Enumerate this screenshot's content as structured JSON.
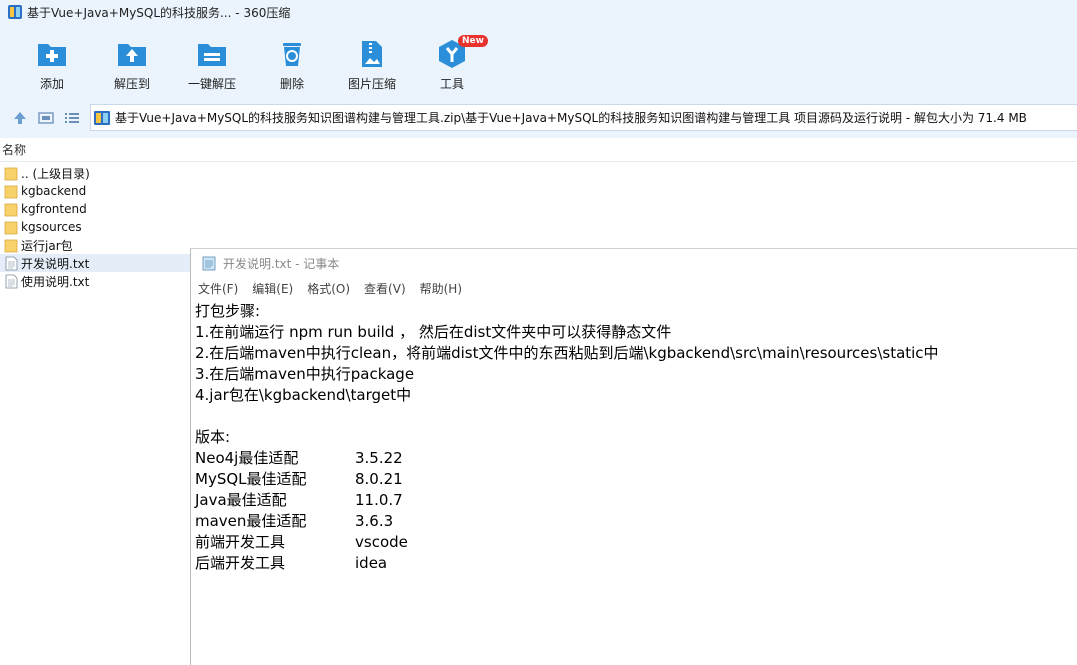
{
  "window": {
    "title": "基于Vue+Java+MySQL的科技服务... - 360压缩"
  },
  "toolbar": {
    "buttons": [
      {
        "label": "添加",
        "icon": "add-icon"
      },
      {
        "label": "解压到",
        "icon": "extract-to-icon"
      },
      {
        "label": "一键解压",
        "icon": "one-click-extract-icon"
      },
      {
        "label": "删除",
        "icon": "delete-icon"
      },
      {
        "label": "图片压缩",
        "icon": "image-compress-icon"
      },
      {
        "label": "工具",
        "icon": "tools-icon",
        "badge": "New"
      }
    ]
  },
  "address": {
    "path": "基于Vue+Java+MySQL的科技服务知识图谱构建与管理工具.zip\\基于Vue+Java+MySQL的科技服务知识图谱构建与管理工具 项目源码及运行说明 - 解包大小为 71.4 MB"
  },
  "filelist": {
    "header": "名称",
    "items": [
      {
        "name": ".. (上级目录)",
        "type": "folder"
      },
      {
        "name": "kgbackend",
        "type": "folder"
      },
      {
        "name": "kgfrontend",
        "type": "folder"
      },
      {
        "name": "kgsources",
        "type": "folder"
      },
      {
        "name": "运行jar包",
        "type": "folder"
      },
      {
        "name": "开发说明.txt",
        "type": "txt",
        "selected": true
      },
      {
        "name": "使用说明.txt",
        "type": "txt"
      }
    ]
  },
  "notepad": {
    "title": "开发说明.txt - 记事本",
    "menu": [
      "文件(F)",
      "编辑(E)",
      "格式(O)",
      "查看(V)",
      "帮助(H)"
    ],
    "lines": [
      "打包步骤:",
      "1.在前端运行 npm run build ， 然后在dist文件夹中可以获得静态文件",
      "2.在后端maven中执行clean，将前端dist文件中的东西粘贴到后端\\kgbackend\\src\\main\\resources\\static中",
      "3.在后端maven中执行package",
      "4.jar包在\\kgbackend\\target中",
      "",
      "版本:"
    ],
    "versions": [
      {
        "name": "Neo4j最佳适配",
        "value": "3.5.22"
      },
      {
        "name": "MySQL最佳适配",
        "value": "8.0.21"
      },
      {
        "name": "Java最佳适配",
        "value": "11.0.7"
      },
      {
        "name": "maven最佳适配",
        "value": "3.6.3"
      },
      {
        "name": "前端开发工具",
        "value": "vscode"
      },
      {
        "name": "后端开发工具",
        "value": "idea"
      }
    ]
  },
  "colors": {
    "chrome_bg": "#ebf4fc",
    "icon_blue": "#2a8fd8",
    "folder_yellow": "#f7d26b",
    "badge_red": "#e8322d"
  }
}
